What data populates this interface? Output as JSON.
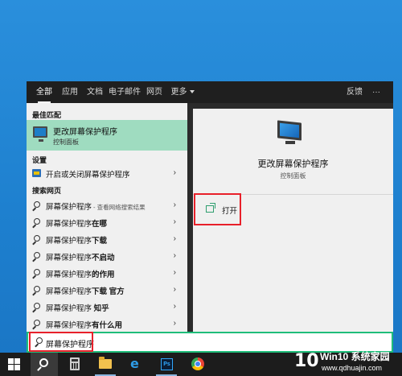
{
  "filter_tabs": [
    "全部",
    "应用",
    "文档",
    "电子邮件",
    "网页",
    "更多"
  ],
  "filter_right": {
    "feedback": "反馈",
    "more": "···"
  },
  "sections": {
    "best_match": "最佳匹配",
    "settings": "设置",
    "web": "搜索网页"
  },
  "best_match_item": {
    "title": "更改屏幕保护程序",
    "subtitle": "控制面板"
  },
  "settings_item": {
    "label": "开启或关闭屏幕保护程序"
  },
  "web_items": [
    {
      "prefix": "屏幕保护程序",
      "suffix": "",
      "hint": "- 查看网络搜索结果"
    },
    {
      "prefix": "屏幕保护程序",
      "suffix": "在哪",
      "hint": ""
    },
    {
      "prefix": "屏幕保护程序",
      "suffix": "下载",
      "hint": ""
    },
    {
      "prefix": "屏幕保护程序",
      "suffix": "不启动",
      "hint": ""
    },
    {
      "prefix": "屏幕保护程序",
      "suffix": "的作用",
      "hint": ""
    },
    {
      "prefix": "屏幕保护程序",
      "suffix": "下载 官方",
      "hint": ""
    },
    {
      "prefix": "屏幕保护程序",
      "suffix": " 知乎",
      "hint": ""
    },
    {
      "prefix": "屏幕保护程序",
      "suffix": "有什么用",
      "hint": ""
    }
  ],
  "detail": {
    "title": "更改屏幕保护程序",
    "subtitle": "控制面板",
    "open_label": "打开"
  },
  "search": {
    "value": "屏幕保护程序"
  },
  "taskbar_icons": [
    "windows-start",
    "search",
    "calculator",
    "file-explorer",
    "edge",
    "photoshop",
    "chrome"
  ],
  "watermark": {
    "logo": "10",
    "title": "Win10 系统家园",
    "url": "www.qdhuajin.com"
  },
  "colors": {
    "desktop": "#1f86d6",
    "panel_dark": "#2b2b2b",
    "best_match_bg": "#9fdcc0",
    "highlight": "#e8202a",
    "search_border": "#1fbd7a"
  }
}
